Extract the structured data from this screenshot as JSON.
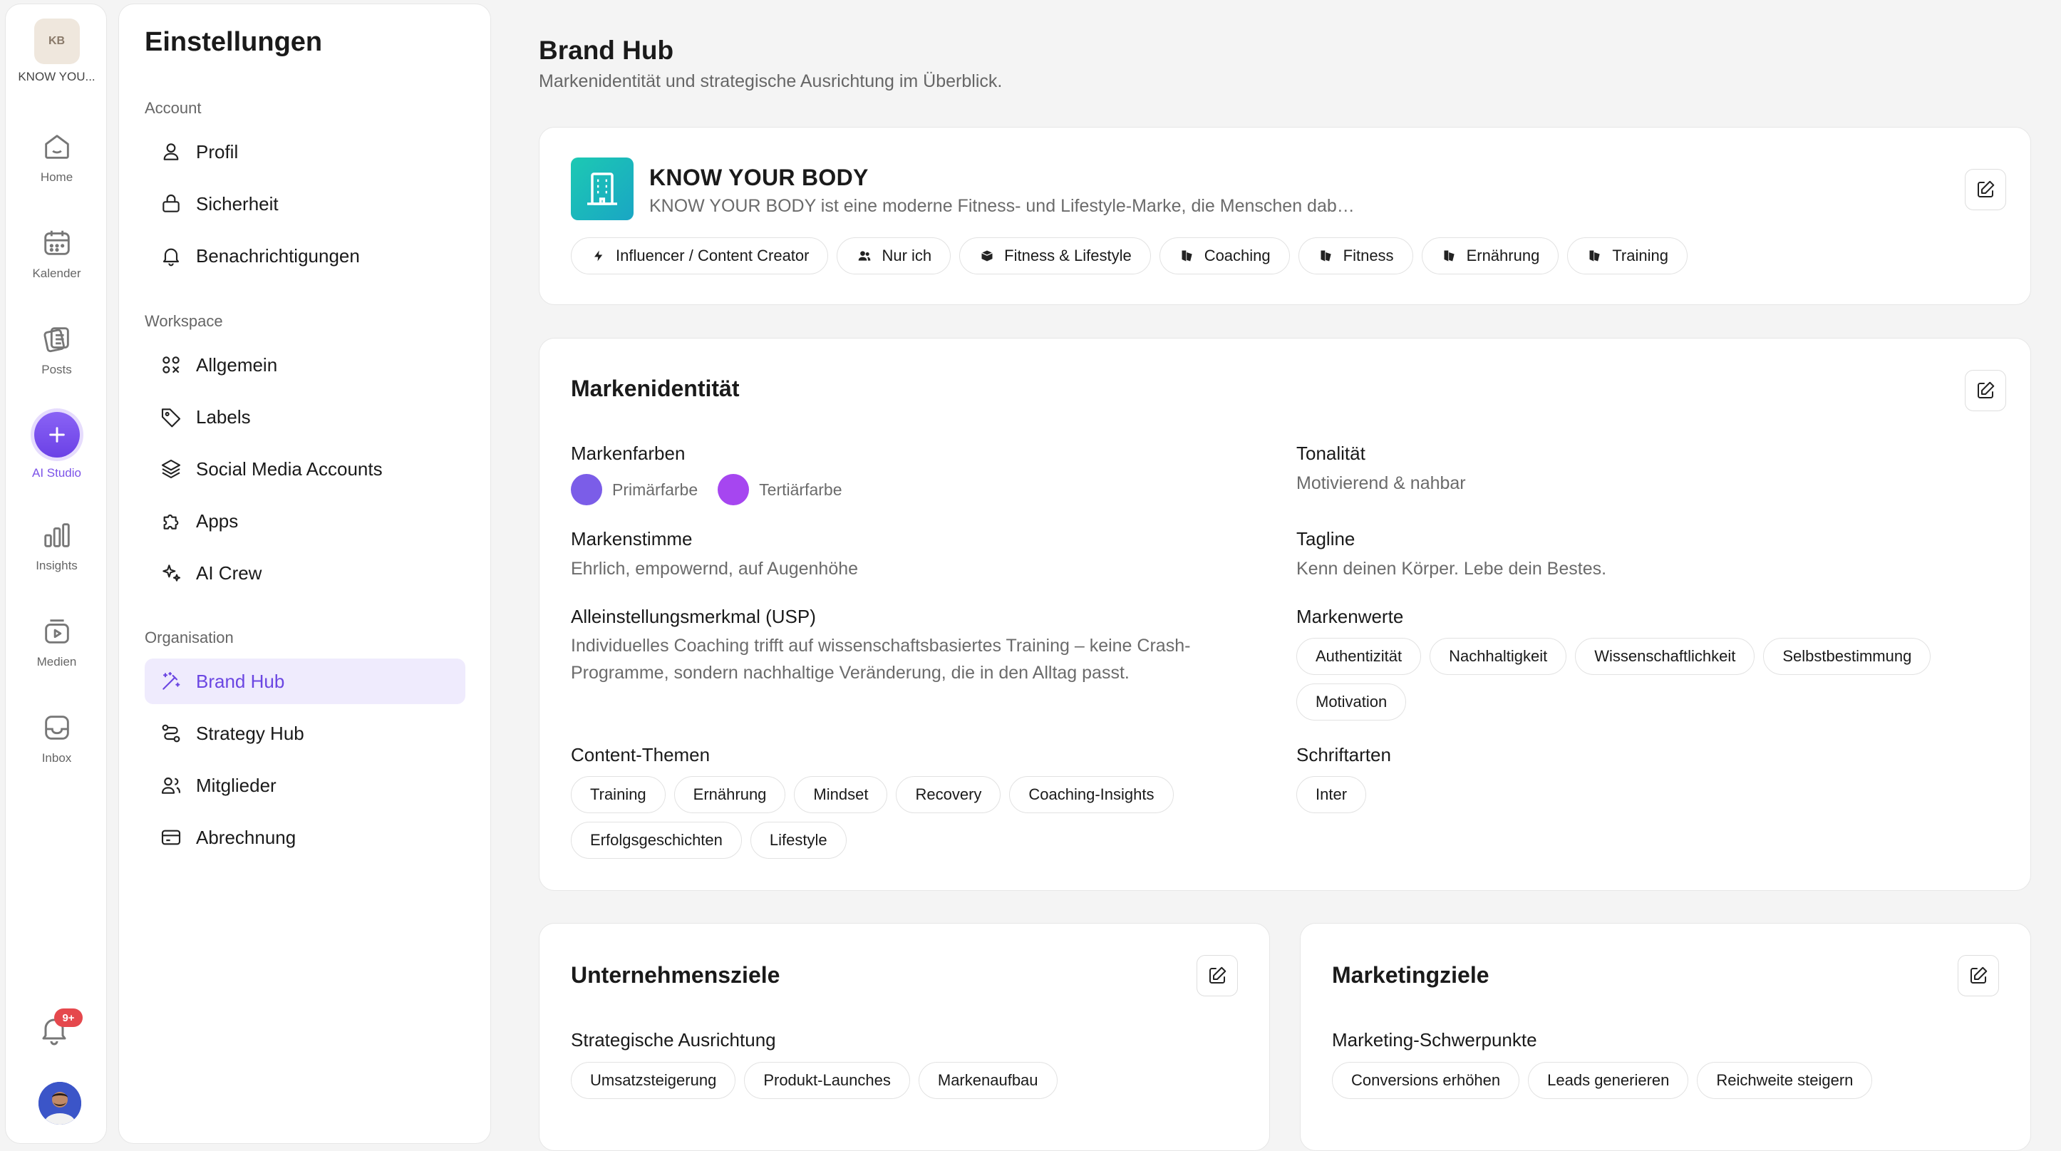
{
  "workspace": {
    "logo_text": "KB",
    "name": "KNOW YOU..."
  },
  "rail": {
    "home": "Home",
    "calendar": "Kalender",
    "posts": "Posts",
    "ai_studio": "AI Studio",
    "insights": "Insights",
    "media": "Medien",
    "inbox": "Inbox",
    "notifications_badge": "9+"
  },
  "settings": {
    "title": "Einstellungen",
    "account_label": "Account",
    "profile": "Profil",
    "security": "Sicherheit",
    "notifications": "Benachrichtigungen",
    "workspace_label": "Workspace",
    "general": "Allgemein",
    "labels": "Labels",
    "social": "Social Media Accounts",
    "apps": "Apps",
    "ai_crew": "AI Crew",
    "org_label": "Organisation",
    "brand_hub": "Brand Hub",
    "strategy_hub": "Strategy Hub",
    "members": "Mitglieder",
    "billing": "Abrechnung"
  },
  "page": {
    "title": "Brand Hub",
    "subtitle": "Markenidentität und strategische Ausrichtung im Überblick."
  },
  "brand": {
    "name": "KNOW YOUR BODY",
    "description": "KNOW YOUR BODY ist eine moderne Fitness- und Lifestyle-Marke, die Menschen dabei hilft, effizient und nachhaltig fitter zu werden. Das Unternehmen setzt auf individuelles Coaching.",
    "tags": [
      {
        "icon": "bolt-icon",
        "label": "Influencer / Content Creator"
      },
      {
        "icon": "users-icon",
        "label": "Nur ich"
      },
      {
        "icon": "box-icon",
        "label": "Fitness & Lifestyle"
      },
      {
        "icon": "tag-icon",
        "label": "Coaching"
      },
      {
        "icon": "tag-icon",
        "label": "Fitness"
      },
      {
        "icon": "tag-icon",
        "label": "Ernährung"
      },
      {
        "icon": "tag-icon",
        "label": "Training"
      }
    ]
  },
  "identity": {
    "title": "Markenidentität",
    "colors_label": "Markenfarben",
    "primary_label": "Primärfarbe",
    "primary_color": "#7b5de8",
    "tertiary_label": "Tertiärfarbe",
    "tertiary_color": "#a646f0",
    "tone_label": "Tonalität",
    "tone_value": "Motivierend & nahbar",
    "voice_label": "Markenstimme",
    "voice_value": "Ehrlich, empowernd, auf Augenhöhe",
    "tagline_label": "Tagline",
    "tagline_value": "Kenn deinen Körper. Lebe dein Bestes.",
    "usp_label": "Alleinstellungsmerkmal (USP)",
    "usp_value": "Individuelles Coaching trifft auf wissenschaftsbasiertes Training – keine Crash-Programme, sondern nachhaltige Veränderung, die in den Alltag passt.",
    "values_label": "Markenwerte",
    "values": [
      "Authentizität",
      "Nachhaltigkeit",
      "Wissenschaftlichkeit",
      "Selbstbestimmung",
      "Motivation"
    ],
    "topics_label": "Content-Themen",
    "topics": [
      "Training",
      "Ernährung",
      "Mindset",
      "Recovery",
      "Coaching-Insights",
      "Erfolgsgeschichten",
      "Lifestyle"
    ],
    "fonts_label": "Schriftarten",
    "fonts": [
      "Inter"
    ]
  },
  "company_goals": {
    "title": "Unternehmensziele",
    "strategy_label": "Strategische Ausrichtung",
    "items": [
      "Umsatzsteigerung",
      "Produkt-Launches",
      "Markenaufbau"
    ]
  },
  "marketing_goals": {
    "title": "Marketingziele",
    "focus_label": "Marketing-Schwerpunkte",
    "items": [
      "Conversions erhöhen",
      "Leads generieren",
      "Reichweite steigern"
    ]
  }
}
